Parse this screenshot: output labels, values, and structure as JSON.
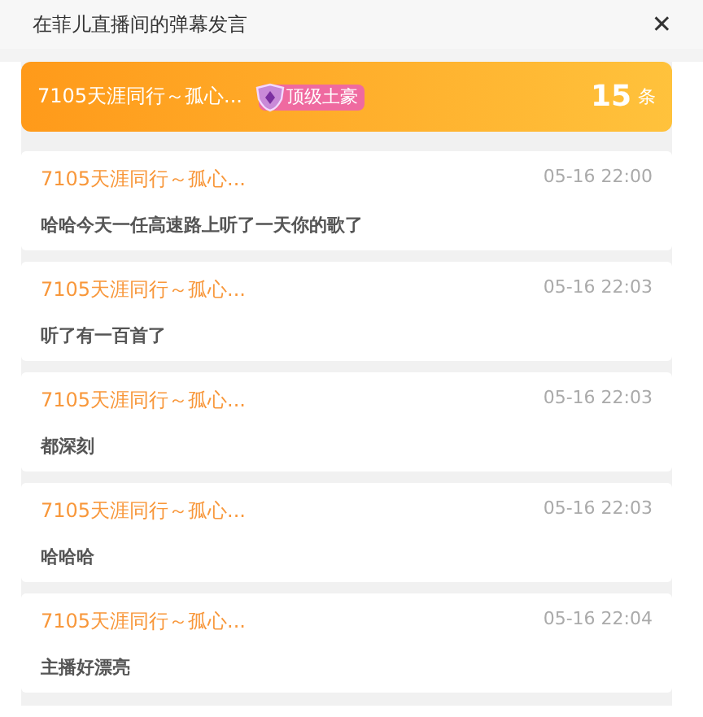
{
  "header": {
    "title": "在菲儿直播间的弹幕发言",
    "close": "✕"
  },
  "user_bar": {
    "name": "7105天涯同行～孤心...",
    "badge": "顶级土豪",
    "count": "15",
    "unit": "条"
  },
  "messages": [
    {
      "name": "7105天涯同行～孤心...",
      "time": "05-16 22:00",
      "text": "哈哈今天一任高速路上听了一天你的歌了"
    },
    {
      "name": "7105天涯同行～孤心...",
      "time": "05-16 22:03",
      "text": "听了有一百首了"
    },
    {
      "name": "7105天涯同行～孤心...",
      "time": "05-16 22:03",
      "text": "都深刻"
    },
    {
      "name": "7105天涯同行～孤心...",
      "time": "05-16 22:03",
      "text": "哈哈哈"
    },
    {
      "name": "7105天涯同行～孤心...",
      "time": "05-16 22:04",
      "text": "主播好漂亮"
    }
  ]
}
